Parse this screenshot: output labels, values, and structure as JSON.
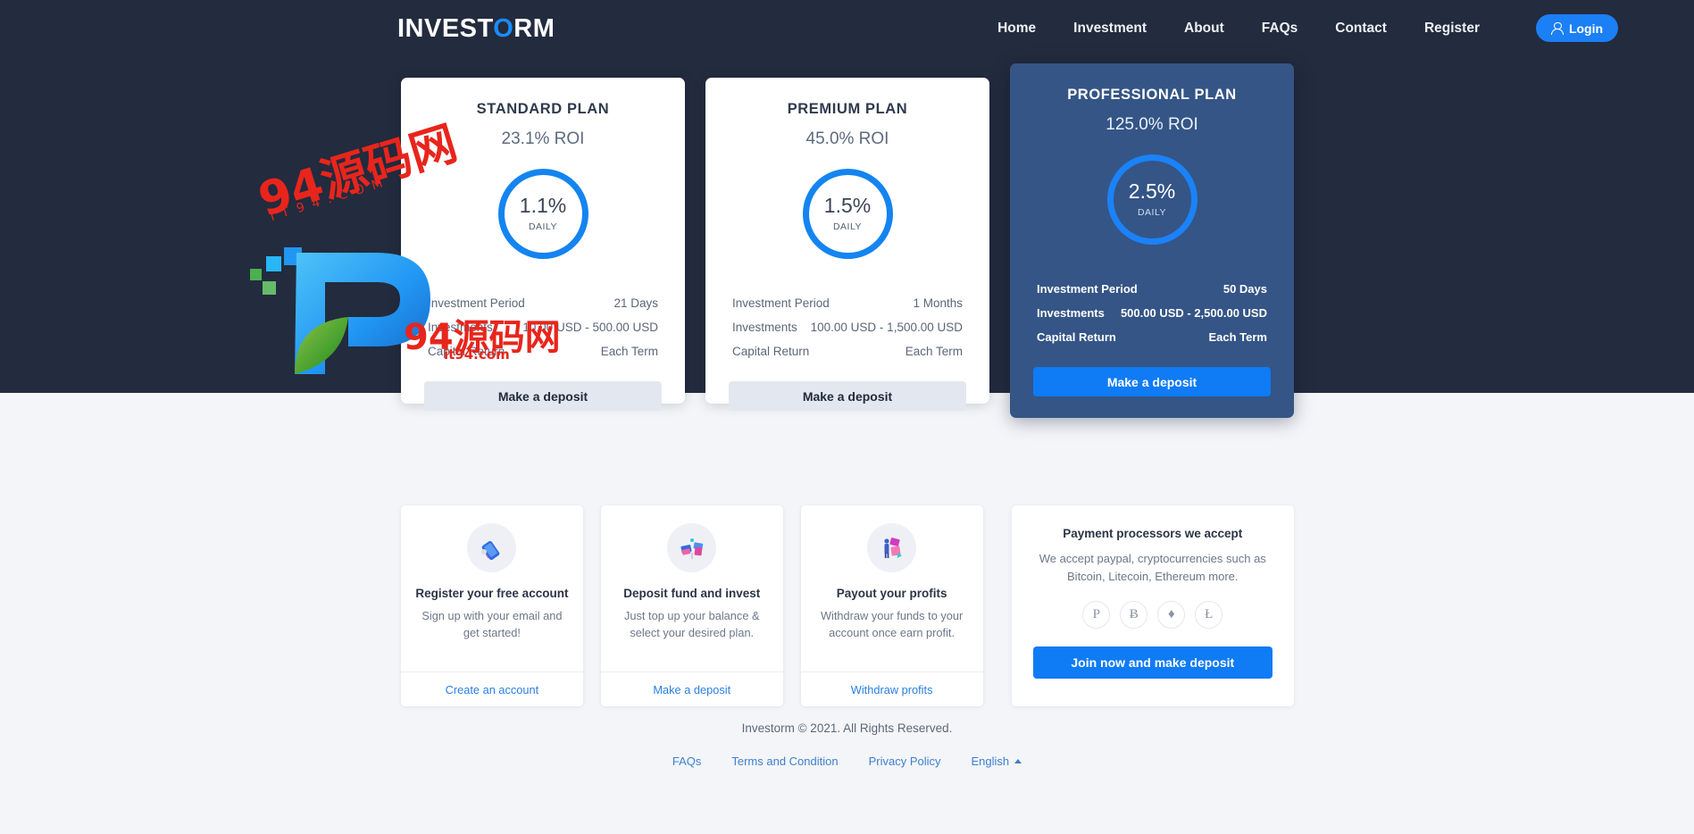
{
  "brand": {
    "text_before": "INVEST",
    "highlight": "O",
    "text_after": "RM"
  },
  "nav": {
    "items": [
      {
        "label": "Home"
      },
      {
        "label": "Investment"
      },
      {
        "label": "About"
      },
      {
        "label": "FAQs"
      },
      {
        "label": "Contact"
      },
      {
        "label": "Register"
      }
    ],
    "login_label": "Login",
    "login_icon": "user-icon"
  },
  "plans": [
    {
      "title": "STANDARD PLAN",
      "roi": "23.1% ROI",
      "rate": "1.1%",
      "rate_unit": "DAILY",
      "specs": [
        {
          "key": "Investment Period",
          "value": "21 Days"
        },
        {
          "key": "Investments",
          "value": "10.00 USD - 500.00 USD"
        },
        {
          "key": "Capital Return",
          "value": "Each Term"
        }
      ],
      "cta": "Make a deposit"
    },
    {
      "title": "PREMIUM PLAN",
      "roi": "45.0% ROI",
      "rate": "1.5%",
      "rate_unit": "DAILY",
      "specs": [
        {
          "key": "Investment Period",
          "value": "1 Months"
        },
        {
          "key": "Investments",
          "value": "100.00 USD - 1,500.00 USD"
        },
        {
          "key": "Capital Return",
          "value": "Each Term"
        }
      ],
      "cta": "Make a deposit"
    },
    {
      "title": "PROFESSIONAL PLAN",
      "roi": "125.0% ROI",
      "rate": "2.5%",
      "rate_unit": "DAILY",
      "specs": [
        {
          "key": "Investment Period",
          "value": "50 Days"
        },
        {
          "key": "Investments",
          "value": "500.00 USD - 2,500.00 USD"
        },
        {
          "key": "Capital Return",
          "value": "Each Term"
        }
      ],
      "cta": "Make a deposit"
    }
  ],
  "features": [
    {
      "icon": "mobile-phone-icon",
      "title": "Register your free account",
      "desc": "Sign up with your email and get started!",
      "link": "Create an account"
    },
    {
      "icon": "deposit-cards-icon",
      "title": "Deposit fund and invest",
      "desc": "Just top up your balance & select your desired plan.",
      "link": "Make a deposit"
    },
    {
      "icon": "payout-person-icon",
      "title": "Payout your profits",
      "desc": "Withdraw your funds to your account once earn profit.",
      "link": "Withdraw profits"
    }
  ],
  "payments": {
    "title": "Payment processors we accept",
    "desc": "We accept paypal, cryptocurrencies such as Bitcoin, Litecoin, Ethereum more.",
    "icons": [
      {
        "name": "paypal-icon",
        "glyph": "P"
      },
      {
        "name": "bitcoin-icon",
        "glyph": "Ƀ"
      },
      {
        "name": "ethereum-icon",
        "glyph": "♦"
      },
      {
        "name": "litecoin-icon",
        "glyph": "Ł"
      }
    ],
    "cta": "Join now and make deposit"
  },
  "footer": {
    "copyright": "Investorm © 2021. All Rights Reserved.",
    "links": [
      {
        "label": "FAQs"
      },
      {
        "label": "Terms and Condition"
      },
      {
        "label": "Privacy Policy"
      }
    ],
    "language": "English"
  },
  "watermark": {
    "main_top": "94源码网",
    "sub_top": "IT94.COM",
    "main_bottom": "94源码网",
    "sub_bottom": "it94.com",
    "color": "#e8251c"
  },
  "colors": {
    "hero_bg": "#232b3e",
    "page_bg": "#f4f5f9",
    "accent_blue": "#0f7bf4",
    "highlight_card": "#345586",
    "link_blue": "#2a7fe0"
  }
}
